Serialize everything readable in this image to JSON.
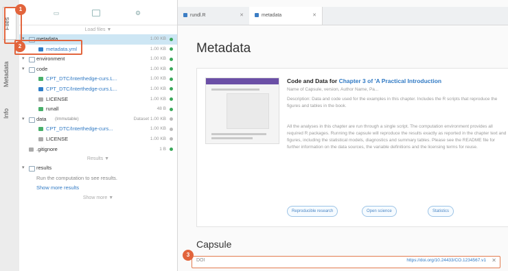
{
  "rail": {
    "tabs": [
      {
        "label": "Files"
      },
      {
        "label": "Metadata"
      },
      {
        "label": "Info"
      }
    ]
  },
  "tree": {
    "toolbar_icons": [
      "document-icon",
      "folder-icon",
      "gear-icon"
    ],
    "hint_top": "Load files ▼",
    "rows": [
      {
        "name": "metadata",
        "meta": "1.00 KB",
        "type": "folder",
        "depth": 0,
        "selected": true,
        "status": "green"
      },
      {
        "name": "metadata.yml",
        "meta": "1.00 KB",
        "type": "file-blue",
        "depth": 1,
        "status": "green",
        "link": true
      },
      {
        "name": "environment",
        "meta": "1.00 KB",
        "type": "folder",
        "depth": 0,
        "status": "green"
      },
      {
        "name": "code",
        "meta": "1.00 KB",
        "type": "folder",
        "depth": 0,
        "status": "green"
      },
      {
        "name": "CPT_DTC/Interthedge-curs.L...",
        "meta": "1.00 KB",
        "type": "file-green",
        "depth": 1,
        "status": "green",
        "link": true
      },
      {
        "name": "CPT_DTC/Interthedge-curs.L...",
        "meta": "1.00 KB",
        "type": "file-blue",
        "depth": 1,
        "status": "green",
        "link": true
      },
      {
        "name": "LICENSE",
        "meta": "1.00 KB",
        "type": "file-grey",
        "depth": 1,
        "status": "green"
      },
      {
        "name": "runall",
        "meta": "48 B",
        "type": "file-green",
        "depth": 1,
        "status": "green"
      },
      {
        "name": "data",
        "meta": "Dataset 1.00 KB",
        "type": "folder",
        "depth": 0,
        "status": "grey",
        "extra": "(Immutable)"
      },
      {
        "name": "CPT_DTC/Interthedge-curs...",
        "meta": "1.00 KB",
        "type": "file-green",
        "depth": 1,
        "status": "grey",
        "link": true
      },
      {
        "name": "LICENSE",
        "meta": "1.00 KB",
        "type": "file-grey",
        "depth": 1,
        "status": "grey"
      },
      {
        "name": ".gitignore",
        "meta": "1 B",
        "type": "file-grey",
        "depth": 0,
        "status": "green"
      }
    ],
    "hint_mid": "Results ▼",
    "results": {
      "name": "results",
      "note": "Run the computation to see results.",
      "link": "Show more results"
    },
    "hint_bottom": "Show more ▼"
  },
  "tabs": [
    {
      "label": "rundl.R",
      "close": "✕"
    },
    {
      "label": "metadata",
      "close": "✕"
    }
  ],
  "page": {
    "title": "Metadata"
  },
  "card": {
    "title_prefix": "Code and Data for",
    "title_accent": "Chapter 3 of 'A Practical Introduction",
    "subtitle": "Name of Capsule, version, Author Name, Pa...",
    "description": "Description: Data and code used for the examples in this chapter. Includes the R scripts that reproduce the figures and tables in the book.",
    "body": "All the analyses in this chapter are run through a single script. The computation environment provides all required R packages. Running the capsule will reproduce the results exactly as reported in the chapter text and figures, including the statistical models, diagnostics and summary tables. Please see the README file for further information on the data sources, the variable definitions and the licensing terms for reuse.",
    "chips": [
      "Reproducible research",
      "Open science",
      "Statistics"
    ]
  },
  "capsule": {
    "title": "Capsule",
    "label": "DOI",
    "link": "https://doi.org/10.24433/CO.1234567.v1",
    "close": "✕"
  },
  "highlights": [
    {
      "number": "1"
    },
    {
      "number": "2"
    },
    {
      "number": "3"
    }
  ],
  "colors": {
    "accent": "#e2643c",
    "link": "#2f79c4",
    "selection": "#cde6f4",
    "ok": "#3aa85a"
  }
}
